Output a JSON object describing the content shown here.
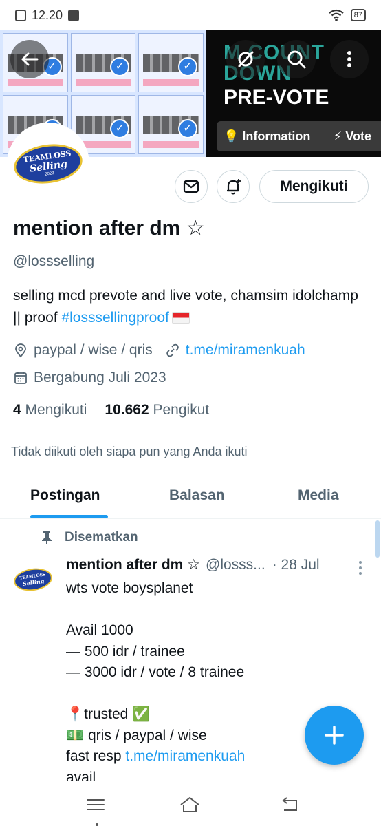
{
  "status_bar": {
    "time": "12.20",
    "battery": "87"
  },
  "banner": {
    "tile_text": [
      "You have completed the",
      "You have completed the",
      "You have completed the",
      "You have completed the",
      "You have completed the",
      "You have completed the"
    ],
    "title_line1": "M COUNT",
    "title_line2": "DOWN",
    "title_line3": "PRE-VOTE",
    "tab_information": "Information",
    "tab_vote": "Vote"
  },
  "avatar": {
    "line1": "TEAMLOSS",
    "line2": "Selling",
    "line3": "2023"
  },
  "actions": {
    "follow_label": "Mengikuti"
  },
  "profile": {
    "name": "mention after dm ☆",
    "handle": "@lossselling",
    "bio_text": "selling mcd prevote and live vote, chamsim idolchamp || proof ",
    "bio_hashtag": "#losssellingproof",
    "location": "paypal / wise / qris",
    "website": "t.me/miramenkuah",
    "joined": "Bergabung Juli 2023",
    "following_count": "4",
    "following_label": "Mengikuti",
    "followers_count": "10.662",
    "followers_label": "Pengikut",
    "not_followed_text": "Tidak diikuti oleh siapa pun yang Anda ikuti"
  },
  "tabs": [
    "Postingan",
    "Balasan",
    "Media"
  ],
  "post": {
    "pinned_label": "Disematkan",
    "author_name": "mention after dm ☆",
    "author_handle": "@losss...",
    "date": "· 28 Jul",
    "body": "wts vote boysplanet\n\nAvail 1000\n— 500 idr / trainee\n— 3000 idr / vote / 8 trainee\n\n📍trusted ✅\n💵 qris / paypal / wise\nfast resp ",
    "body_link": "t.me/miramenkuah",
    "body_tail": "avail"
  },
  "colors": {
    "accent": "#1d9bf0",
    "text": "#0f1419",
    "secondary": "#536471"
  }
}
